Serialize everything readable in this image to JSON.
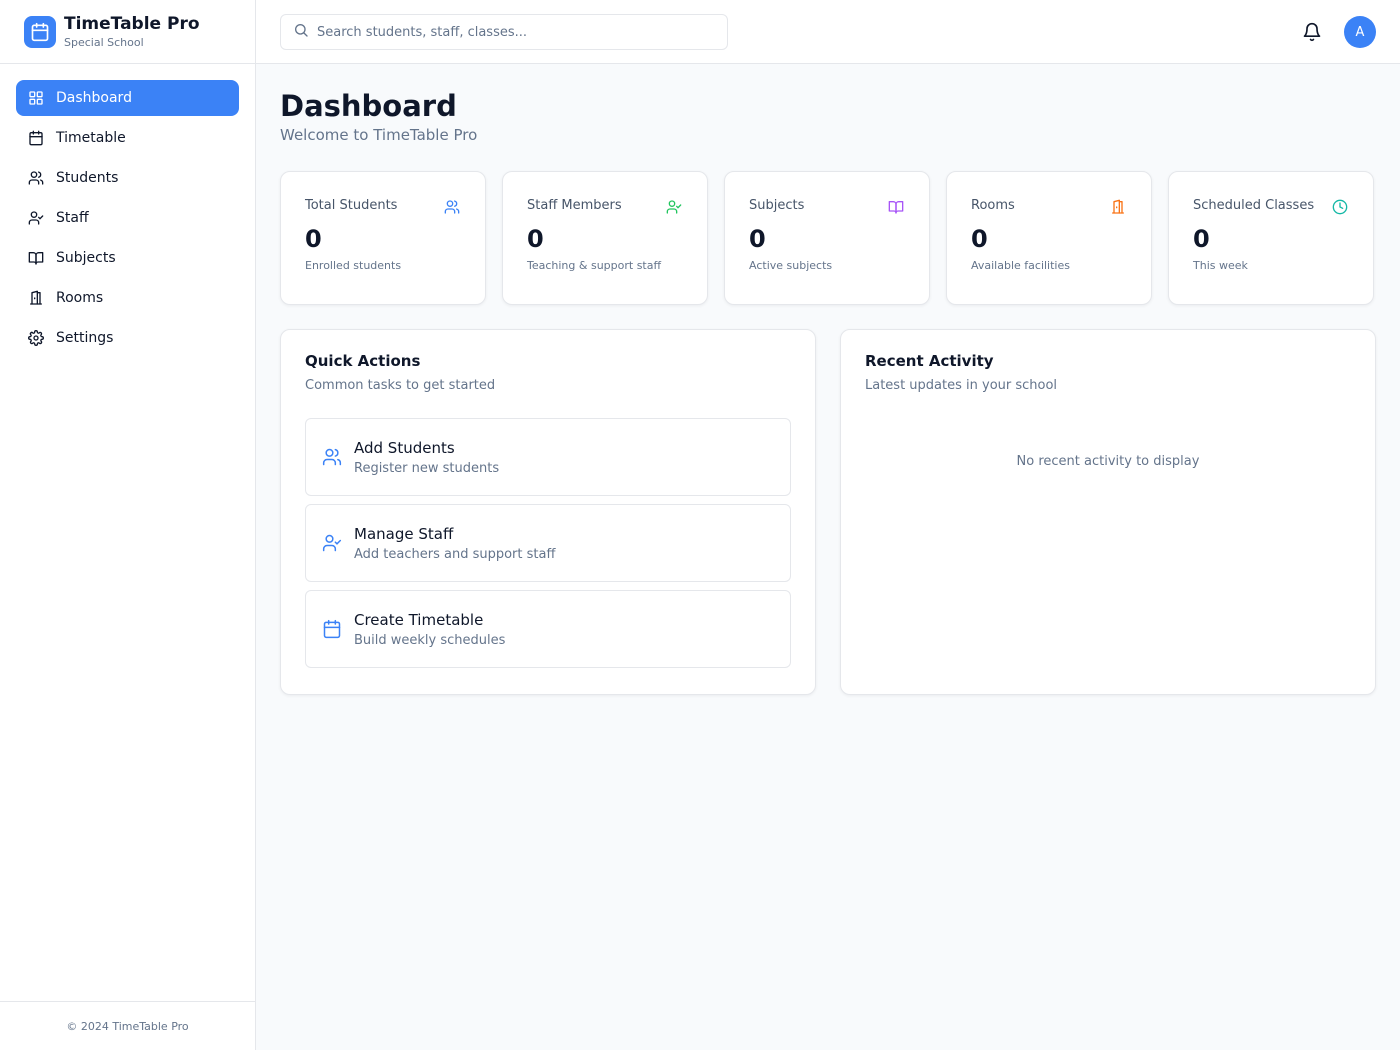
{
  "brand": {
    "title": "TimeTable Pro",
    "subtitle": "Special School",
    "icon": "calendar-icon"
  },
  "nav": {
    "items": [
      {
        "label": "Dashboard",
        "icon": "grid-icon",
        "active": true
      },
      {
        "label": "Timetable",
        "icon": "calendar-icon"
      },
      {
        "label": "Students",
        "icon": "users-icon"
      },
      {
        "label": "Staff",
        "icon": "user-check-icon"
      },
      {
        "label": "Subjects",
        "icon": "book-icon"
      },
      {
        "label": "Rooms",
        "icon": "door-icon"
      },
      {
        "label": "Settings",
        "icon": "gear-icon"
      }
    ]
  },
  "footer": {
    "text": "© 2024 TimeTable Pro"
  },
  "header": {
    "search_placeholder": "Search students, staff, classes...",
    "avatar_initial": "A"
  },
  "page": {
    "title": "Dashboard",
    "subtitle": "Welcome to TimeTable Pro"
  },
  "stats": [
    {
      "label": "Total Students",
      "value": "0",
      "desc": "Enrolled students",
      "icon": "users-icon",
      "color": "#3b82f6"
    },
    {
      "label": "Staff Members",
      "value": "0",
      "desc": "Teaching & support staff",
      "icon": "user-check-icon",
      "color": "#22c55e"
    },
    {
      "label": "Subjects",
      "value": "0",
      "desc": "Active subjects",
      "icon": "book-icon",
      "color": "#a855f7"
    },
    {
      "label": "Rooms",
      "value": "0",
      "desc": "Available facilities",
      "icon": "door-icon",
      "color": "#f97316"
    },
    {
      "label": "Scheduled Classes",
      "value": "0",
      "desc": "This week",
      "icon": "clock-icon",
      "color": "#14b8a6"
    }
  ],
  "quick_actions": {
    "title": "Quick Actions",
    "subtitle": "Common tasks to get started",
    "items": [
      {
        "title": "Add Students",
        "desc": "Register new students",
        "icon": "users-icon"
      },
      {
        "title": "Manage Staff",
        "desc": "Add teachers and support staff",
        "icon": "user-check-icon"
      },
      {
        "title": "Create Timetable",
        "desc": "Build weekly schedules",
        "icon": "calendar-icon"
      }
    ]
  },
  "recent_activity": {
    "title": "Recent Activity",
    "subtitle": "Latest updates in your school",
    "empty_text": "No recent activity to display"
  },
  "colors": {
    "accent": "#3b82f6",
    "border": "#e5e7eb",
    "muted": "#64748b"
  }
}
